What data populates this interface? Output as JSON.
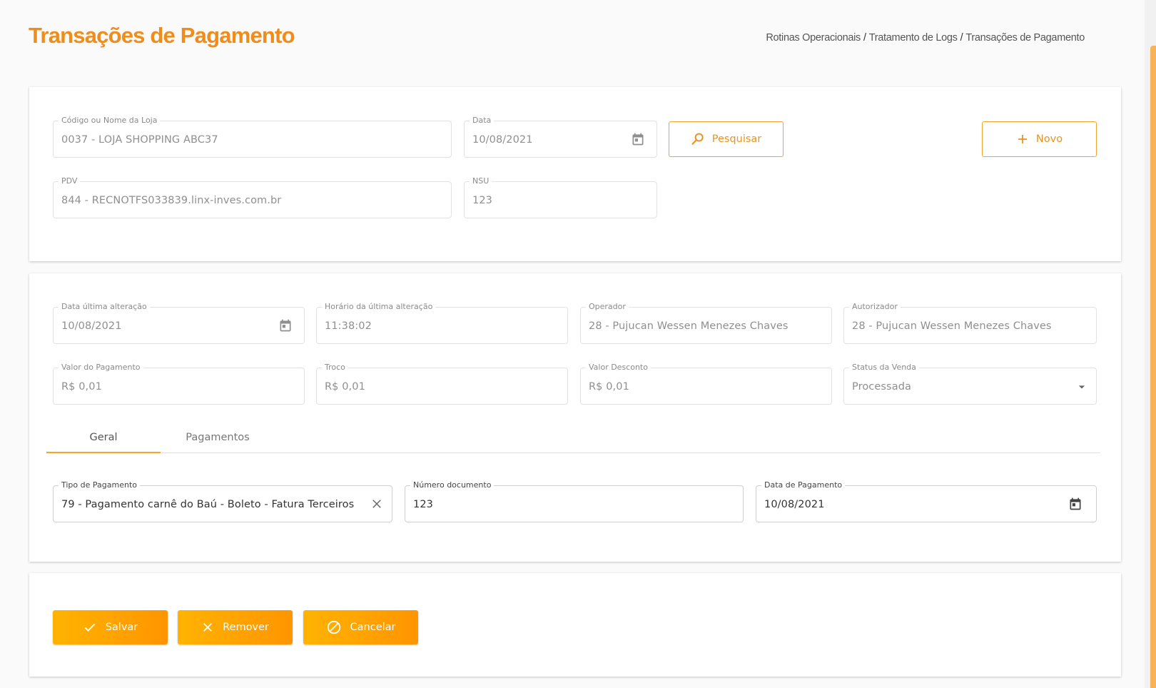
{
  "header": {
    "title": "Transações de Pagamento",
    "breadcrumb": [
      "Rotinas Operacionais",
      "Tratamento de Logs",
      "Transações de Pagamento"
    ],
    "separator": "/"
  },
  "search": {
    "store": {
      "label": "Código ou Nome da Loja",
      "value": "0037 - LOJA SHOPPING ABC37"
    },
    "date": {
      "label": "Data",
      "value": "10/08/2021"
    },
    "pdv": {
      "label": "PDV",
      "value": "844 - RECNOTFS033839.linx-inves.com.br"
    },
    "nsu": {
      "label": "NSU",
      "value": "123"
    },
    "search_label": "Pesquisar",
    "new_label": "Novo"
  },
  "details": {
    "last_change_date": {
      "label": "Data última alteração",
      "value": "10/08/2021"
    },
    "last_change_time": {
      "label": "Horário da última alteração",
      "value": "11:38:02"
    },
    "operator": {
      "label": "Operador",
      "value": "28 - Pujucan Wessen Menezes Chaves"
    },
    "authorizer": {
      "label": "Autorizador",
      "value": "28 - Pujucan Wessen Menezes Chaves"
    },
    "payment_value": {
      "label": "Valor do Pagamento",
      "value": "R$ 0,01"
    },
    "change": {
      "label": "Troco",
      "value": "R$ 0,01"
    },
    "discount": {
      "label": "Valor Desconto",
      "value": "R$ 0,01"
    },
    "sale_status": {
      "label": "Status da Venda",
      "value": "Processada"
    }
  },
  "tabs": [
    "Geral",
    "Pagamentos"
  ],
  "general": {
    "payment_type": {
      "label": "Tipo de Pagamento",
      "value": "79 - Pagamento carnê do Baú - Boleto - Fatura Terceiros"
    },
    "document_number": {
      "label": "Número documento",
      "value": "123"
    },
    "payment_date": {
      "label": "Data de Pagamento",
      "value": "10/08/2021"
    }
  },
  "actions": {
    "save_label": "Salvar",
    "remove_label": "Remover",
    "cancel_label": "Cancelar"
  },
  "colors": {
    "accent": "#f08c1a",
    "button_gradient_start": "#ffb300",
    "button_gradient_end": "#ff9500",
    "outline": "#f2a42e"
  }
}
